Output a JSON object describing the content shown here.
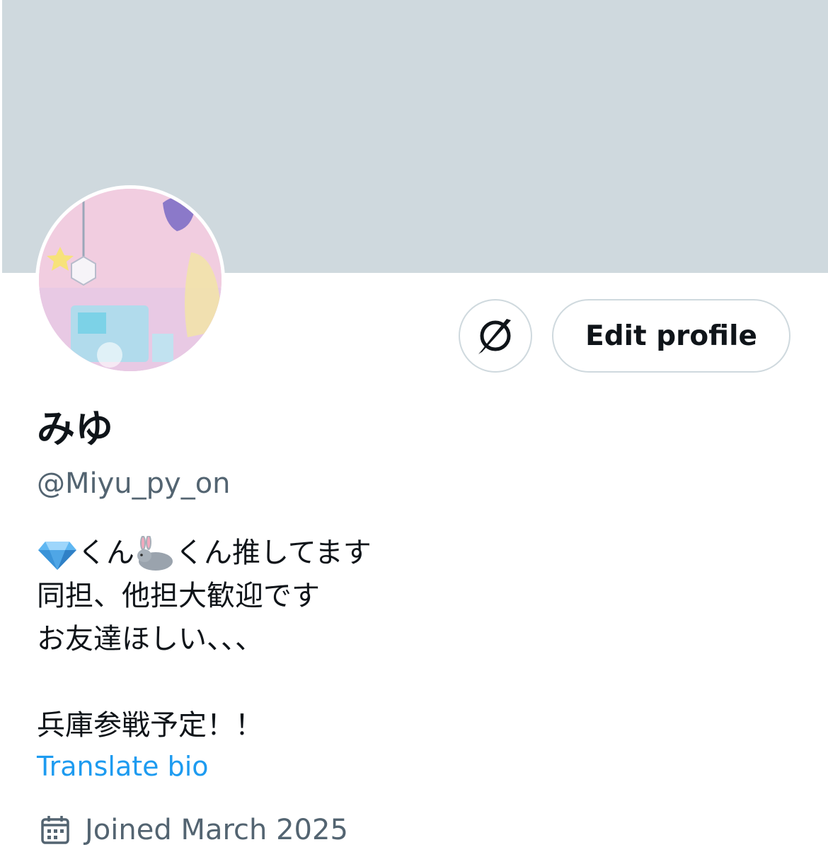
{
  "profile": {
    "display_name": "みゆ",
    "handle": "@Miyu_py_on",
    "bio": {
      "line1_a": "くん",
      "line1_b": "くん推してます",
      "line2": "同担、他担大歓迎です",
      "line3": "お友達ほしい、、、",
      "line4": "",
      "line5": "兵庫参戦予定！！"
    },
    "translate_label": "Translate bio",
    "joined_label": "Joined March 2025"
  },
  "actions": {
    "edit_profile_label": "Edit profile",
    "icon_button": "grok-icon"
  },
  "icons": {
    "bio_emoji_1": "gem-icon",
    "bio_emoji_2": "rabbit-icon",
    "joined": "calendar-icon"
  },
  "colors": {
    "banner": "#cfd9de",
    "link": "#1d9bf0",
    "secondary_text": "#536471",
    "border": "#cfd9de"
  }
}
